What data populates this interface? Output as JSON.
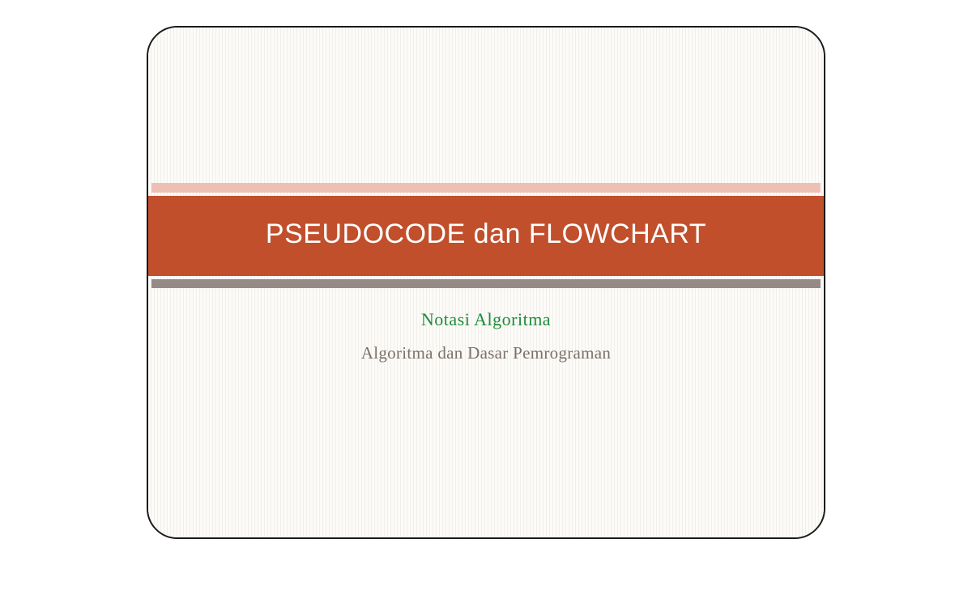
{
  "slide": {
    "title": "PSEUDOCODE dan FLOWCHART",
    "subtitle_primary": "Notasi Algoritma",
    "subtitle_secondary": "Algoritma dan Dasar Pemrograman"
  },
  "colors": {
    "title_band": "#c14f2c",
    "accent_top": "#eec0b5",
    "accent_bottom": "#968a87",
    "subtitle_primary": "#1f8b3b",
    "subtitle_secondary": "#7d7069"
  }
}
